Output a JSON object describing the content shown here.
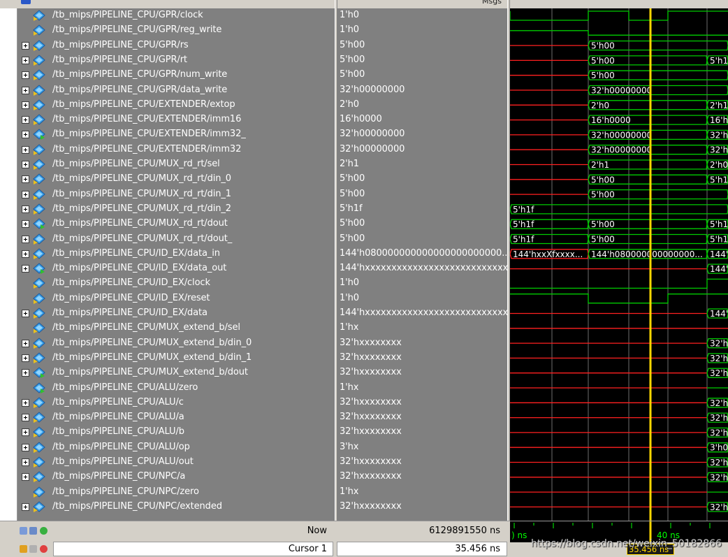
{
  "toolbar": {
    "msgs_label": "Msgs"
  },
  "colors": {
    "pane_bg": "#808080",
    "wave_bg": "#000000",
    "wave_green": "#00cc00",
    "wave_red": "#ff2020",
    "cursor_yellow": "#ffd700",
    "grid_line": "#c8c8c8"
  },
  "signals": [
    {
      "name": "/tb_mips/PIPELINE_CPU/GPR/clock",
      "value": "1'h0",
      "expandable": false,
      "icon": "signal-in-icon"
    },
    {
      "name": "/tb_mips/PIPELINE_CPU/GPR/reg_write",
      "value": "1'h0",
      "expandable": false,
      "icon": "signal-in-icon"
    },
    {
      "name": "/tb_mips/PIPELINE_CPU/GPR/rs",
      "value": "5'h00",
      "expandable": true,
      "icon": "signal-in-icon"
    },
    {
      "name": "/tb_mips/PIPELINE_CPU/GPR/rt",
      "value": "5'h00",
      "expandable": true,
      "icon": "signal-in-icon"
    },
    {
      "name": "/tb_mips/PIPELINE_CPU/GPR/num_write",
      "value": "5'h00",
      "expandable": true,
      "icon": "signal-in-icon"
    },
    {
      "name": "/tb_mips/PIPELINE_CPU/GPR/data_write",
      "value": "32'h00000000",
      "expandable": true,
      "icon": "signal-in-icon"
    },
    {
      "name": "/tb_mips/PIPELINE_CPU/EXTENDER/extop",
      "value": "2'h0",
      "expandable": true,
      "icon": "signal-in-icon"
    },
    {
      "name": "/tb_mips/PIPELINE_CPU/EXTENDER/imm16",
      "value": "16'h0000",
      "expandable": true,
      "icon": "signal-in-icon"
    },
    {
      "name": "/tb_mips/PIPELINE_CPU/EXTENDER/imm32_",
      "value": "32'h00000000",
      "expandable": true,
      "icon": "signal-out-icon"
    },
    {
      "name": "/tb_mips/PIPELINE_CPU/EXTENDER/imm32",
      "value": "32'h00000000",
      "expandable": true,
      "icon": "signal-in-icon"
    },
    {
      "name": "/tb_mips/PIPELINE_CPU/MUX_rd_rt/sel",
      "value": "2'h1",
      "expandable": true,
      "icon": "signal-in-icon"
    },
    {
      "name": "/tb_mips/PIPELINE_CPU/MUX_rd_rt/din_0",
      "value": "5'h00",
      "expandable": true,
      "icon": "signal-in-icon"
    },
    {
      "name": "/tb_mips/PIPELINE_CPU/MUX_rd_rt/din_1",
      "value": "5'h00",
      "expandable": true,
      "icon": "signal-in-icon"
    },
    {
      "name": "/tb_mips/PIPELINE_CPU/MUX_rd_rt/din_2",
      "value": "5'h1f",
      "expandable": true,
      "icon": "signal-in-icon"
    },
    {
      "name": "/tb_mips/PIPELINE_CPU/MUX_rd_rt/dout",
      "value": "5'h00",
      "expandable": true,
      "icon": "signal-out-icon"
    },
    {
      "name": "/tb_mips/PIPELINE_CPU/MUX_rd_rt/dout_",
      "value": "5'h00",
      "expandable": true,
      "icon": "signal-in-icon"
    },
    {
      "name": "/tb_mips/PIPELINE_CPU/ID_EX/data_in",
      "value": "144'h080000000000000000000000...",
      "expandable": true,
      "icon": "signal-in-icon"
    },
    {
      "name": "/tb_mips/PIPELINE_CPU/ID_EX/data_out",
      "value": "144'hxxxxxxxxxxxxxxxxxxxxxxxxxxx...",
      "expandable": true,
      "icon": "signal-out-icon"
    },
    {
      "name": "/tb_mips/PIPELINE_CPU/ID_EX/clock",
      "value": "1'h0",
      "expandable": false,
      "icon": "signal-in-icon"
    },
    {
      "name": "/tb_mips/PIPELINE_CPU/ID_EX/reset",
      "value": "1'h0",
      "expandable": false,
      "icon": "signal-in-icon"
    },
    {
      "name": "/tb_mips/PIPELINE_CPU/ID_EX/data",
      "value": "144'hxxxxxxxxxxxxxxxxxxxxxxxxxxx...",
      "expandable": true,
      "icon": "signal-in-icon"
    },
    {
      "name": "/tb_mips/PIPELINE_CPU/MUX_extend_b/sel",
      "value": "1'hx",
      "expandable": false,
      "icon": "signal-in-icon"
    },
    {
      "name": "/tb_mips/PIPELINE_CPU/MUX_extend_b/din_0",
      "value": "32'hxxxxxxxx",
      "expandable": true,
      "icon": "signal-in-icon"
    },
    {
      "name": "/tb_mips/PIPELINE_CPU/MUX_extend_b/din_1",
      "value": "32'hxxxxxxxx",
      "expandable": true,
      "icon": "signal-in-icon"
    },
    {
      "name": "/tb_mips/PIPELINE_CPU/MUX_extend_b/dout",
      "value": "32'hxxxxxxxx",
      "expandable": true,
      "icon": "signal-out-icon"
    },
    {
      "name": "/tb_mips/PIPELINE_CPU/ALU/zero",
      "value": "1'hx",
      "expandable": false,
      "icon": "signal-out-icon"
    },
    {
      "name": "/tb_mips/PIPELINE_CPU/ALU/c",
      "value": "32'hxxxxxxxx",
      "expandable": true,
      "icon": "signal-in-icon"
    },
    {
      "name": "/tb_mips/PIPELINE_CPU/ALU/a",
      "value": "32'hxxxxxxxx",
      "expandable": true,
      "icon": "signal-in-icon"
    },
    {
      "name": "/tb_mips/PIPELINE_CPU/ALU/b",
      "value": "32'hxxxxxxxx",
      "expandable": true,
      "icon": "signal-in-icon"
    },
    {
      "name": "/tb_mips/PIPELINE_CPU/ALU/op",
      "value": "3'hx",
      "expandable": true,
      "icon": "signal-in-icon"
    },
    {
      "name": "/tb_mips/PIPELINE_CPU/ALU/out",
      "value": "32'hxxxxxxxx",
      "expandable": true,
      "icon": "signal-in-icon"
    },
    {
      "name": "/tb_mips/PIPELINE_CPU/NPC/a",
      "value": "32'hxxxxxxxx",
      "expandable": true,
      "icon": "signal-in-icon"
    },
    {
      "name": "/tb_mips/PIPELINE_CPU/NPC/zero",
      "value": "1'hx",
      "expandable": false,
      "icon": "signal-in-icon"
    },
    {
      "name": "/tb_mips/PIPELINE_CPU/NPC/extended",
      "value": "32'hxxxxxxxx",
      "expandable": true,
      "icon": "signal-in-icon"
    }
  ],
  "waves": [
    {
      "kind": "clock"
    },
    {
      "kind": "bit",
      "level": "low-green"
    },
    {
      "kind": "bus",
      "segments": [
        {
          "from": 0,
          "to": 112,
          "color": "red",
          "label": ""
        },
        {
          "from": 112,
          "to": 312,
          "color": "green",
          "label": "5'h00"
        }
      ]
    },
    {
      "kind": "bus",
      "segments": [
        {
          "from": 0,
          "to": 112,
          "color": "red",
          "label": ""
        },
        {
          "from": 112,
          "to": 282,
          "color": "green",
          "label": "5'h00"
        },
        {
          "from": 282,
          "to": 312,
          "color": "green",
          "label": "5'h1f"
        }
      ]
    },
    {
      "kind": "bus",
      "segments": [
        {
          "from": 0,
          "to": 112,
          "color": "red",
          "label": ""
        },
        {
          "from": 112,
          "to": 312,
          "color": "green",
          "label": "5'h00"
        }
      ]
    },
    {
      "kind": "bus",
      "segments": [
        {
          "from": 0,
          "to": 112,
          "color": "red",
          "label": ""
        },
        {
          "from": 112,
          "to": 312,
          "color": "green",
          "label": "32'h00000000"
        }
      ]
    },
    {
      "kind": "bus",
      "segments": [
        {
          "from": 0,
          "to": 112,
          "color": "red",
          "label": ""
        },
        {
          "from": 112,
          "to": 282,
          "color": "green",
          "label": "2'h0"
        },
        {
          "from": 282,
          "to": 312,
          "color": "green",
          "label": "2'h1"
        }
      ]
    },
    {
      "kind": "bus",
      "segments": [
        {
          "from": 0,
          "to": 112,
          "color": "red",
          "label": ""
        },
        {
          "from": 112,
          "to": 282,
          "color": "green",
          "label": "16'h0000"
        },
        {
          "from": 282,
          "to": 312,
          "color": "green",
          "label": "16'h0"
        }
      ]
    },
    {
      "kind": "bus",
      "segments": [
        {
          "from": 0,
          "to": 112,
          "color": "red",
          "label": ""
        },
        {
          "from": 112,
          "to": 282,
          "color": "green",
          "label": "32'h00000000"
        },
        {
          "from": 282,
          "to": 312,
          "color": "green",
          "label": "32'h0"
        }
      ]
    },
    {
      "kind": "bus",
      "segments": [
        {
          "from": 0,
          "to": 112,
          "color": "red",
          "label": ""
        },
        {
          "from": 112,
          "to": 282,
          "color": "green",
          "label": "32'h00000000"
        },
        {
          "from": 282,
          "to": 312,
          "color": "green",
          "label": "32'h0"
        }
      ]
    },
    {
      "kind": "bus",
      "segments": [
        {
          "from": 0,
          "to": 112,
          "color": "red",
          "label": ""
        },
        {
          "from": 112,
          "to": 282,
          "color": "green",
          "label": "2'h1"
        },
        {
          "from": 282,
          "to": 312,
          "color": "green",
          "label": "2'h0"
        }
      ]
    },
    {
      "kind": "bus",
      "segments": [
        {
          "from": 0,
          "to": 112,
          "color": "red",
          "label": ""
        },
        {
          "from": 112,
          "to": 282,
          "color": "green",
          "label": "5'h00"
        },
        {
          "from": 282,
          "to": 312,
          "color": "green",
          "label": "5'h1f"
        }
      ]
    },
    {
      "kind": "bus",
      "segments": [
        {
          "from": 0,
          "to": 112,
          "color": "red",
          "label": ""
        },
        {
          "from": 112,
          "to": 312,
          "color": "green",
          "label": "5'h00"
        }
      ]
    },
    {
      "kind": "bus",
      "segments": [
        {
          "from": 0,
          "to": 312,
          "color": "green",
          "label": "5'h1f"
        }
      ]
    },
    {
      "kind": "bus",
      "segments": [
        {
          "from": 0,
          "to": 112,
          "color": "green",
          "label": "5'h1f"
        },
        {
          "from": 112,
          "to": 282,
          "color": "green",
          "label": "5'h00"
        },
        {
          "from": 282,
          "to": 312,
          "color": "green",
          "label": "5'h1f"
        }
      ]
    },
    {
      "kind": "bus",
      "segments": [
        {
          "from": 0,
          "to": 112,
          "color": "green",
          "label": "5'h1f"
        },
        {
          "from": 112,
          "to": 282,
          "color": "green",
          "label": "5'h00"
        },
        {
          "from": 282,
          "to": 312,
          "color": "green",
          "label": "5'h1f"
        }
      ]
    },
    {
      "kind": "bus",
      "segments": [
        {
          "from": 0,
          "to": 112,
          "color": "red",
          "label": "144'hxxXfxxxx..."
        },
        {
          "from": 112,
          "to": 282,
          "color": "green",
          "label": "144'h080000000000000..."
        },
        {
          "from": 282,
          "to": 312,
          "color": "green",
          "label": "144'"
        }
      ]
    },
    {
      "kind": "bus",
      "segments": [
        {
          "from": 0,
          "to": 282,
          "color": "red",
          "label": ""
        },
        {
          "from": 282,
          "to": 312,
          "color": "green",
          "label": "144'"
        }
      ]
    },
    {
      "kind": "clock2"
    },
    {
      "kind": "reset"
    },
    {
      "kind": "bus",
      "segments": [
        {
          "from": 0,
          "to": 282,
          "color": "red",
          "label": ""
        },
        {
          "from": 282,
          "to": 312,
          "color": "green",
          "label": "144'"
        }
      ]
    },
    {
      "kind": "bit",
      "level": "red"
    },
    {
      "kind": "bus",
      "segments": [
        {
          "from": 0,
          "to": 282,
          "color": "red",
          "label": ""
        },
        {
          "from": 282,
          "to": 312,
          "color": "green",
          "label": "32'h0"
        }
      ]
    },
    {
      "kind": "bus",
      "segments": [
        {
          "from": 0,
          "to": 282,
          "color": "red",
          "label": ""
        },
        {
          "from": 282,
          "to": 312,
          "color": "green",
          "label": "32'h0"
        }
      ]
    },
    {
      "kind": "bus",
      "segments": [
        {
          "from": 0,
          "to": 282,
          "color": "red",
          "label": ""
        },
        {
          "from": 282,
          "to": 312,
          "color": "green",
          "label": "32'h0"
        }
      ]
    },
    {
      "kind": "bit",
      "level": "red-then-green"
    },
    {
      "kind": "bus",
      "segments": [
        {
          "from": 0,
          "to": 282,
          "color": "red",
          "label": ""
        },
        {
          "from": 282,
          "to": 312,
          "color": "green",
          "label": "32'h0"
        }
      ]
    },
    {
      "kind": "bus",
      "segments": [
        {
          "from": 0,
          "to": 282,
          "color": "red",
          "label": ""
        },
        {
          "from": 282,
          "to": 312,
          "color": "green",
          "label": "32'h0"
        }
      ]
    },
    {
      "kind": "bus",
      "segments": [
        {
          "from": 0,
          "to": 282,
          "color": "red",
          "label": ""
        },
        {
          "from": 282,
          "to": 312,
          "color": "green",
          "label": "32'h0"
        }
      ]
    },
    {
      "kind": "bus",
      "segments": [
        {
          "from": 0,
          "to": 282,
          "color": "red",
          "label": ""
        },
        {
          "from": 282,
          "to": 312,
          "color": "green",
          "label": "3'h0"
        }
      ]
    },
    {
      "kind": "bus",
      "segments": [
        {
          "from": 0,
          "to": 282,
          "color": "red",
          "label": ""
        },
        {
          "from": 282,
          "to": 312,
          "color": "green",
          "label": "32'h0"
        }
      ]
    },
    {
      "kind": "bus",
      "segments": [
        {
          "from": 0,
          "to": 282,
          "color": "red",
          "label": ""
        },
        {
          "from": 282,
          "to": 312,
          "color": "green",
          "label": "32'h0"
        }
      ]
    },
    {
      "kind": "bit",
      "level": "red-then-green"
    },
    {
      "kind": "bus",
      "segments": [
        {
          "from": 0,
          "to": 282,
          "color": "red",
          "label": ""
        },
        {
          "from": 282,
          "to": 312,
          "color": "green",
          "label": "32'h0"
        }
      ]
    }
  ],
  "status": {
    "now_label": "Now",
    "now_value": "6129891550 ns",
    "cursor_label": "Cursor 1",
    "cursor_value": "35.456 ns"
  },
  "timeline": {
    "left_label": ") ns",
    "mid_label": "40 ns",
    "cursor_tag": "35.456 ns"
  },
  "watermark": "https://blog.csdn.net/weixin_50182866"
}
